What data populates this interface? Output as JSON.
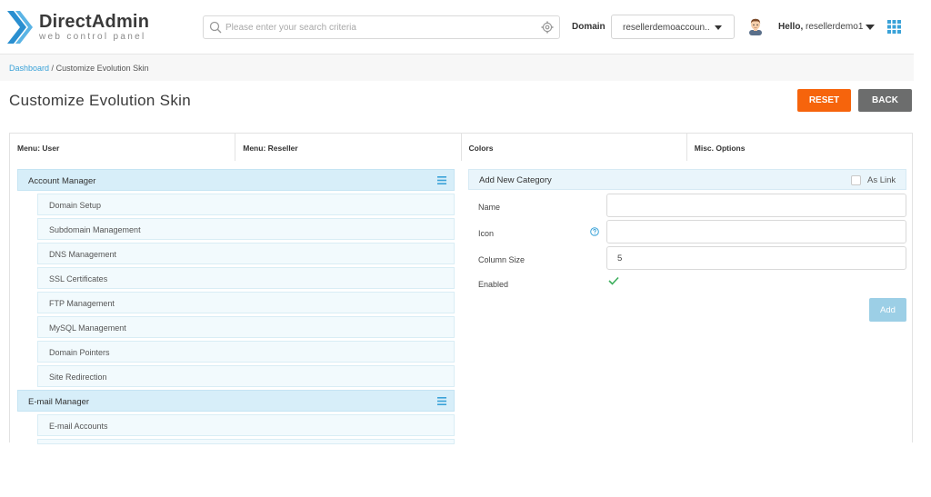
{
  "brand": {
    "title": "DirectAdmin",
    "subtitle": "web control panel"
  },
  "search": {
    "placeholder": "Please enter your search criteria",
    "value": ""
  },
  "domain": {
    "label": "Domain",
    "selected": "resellerdemoaccoun..."
  },
  "user": {
    "greeting": "Hello,",
    "name": "resellerdemo1"
  },
  "breadcrumb": {
    "root": "Dashboard",
    "separator": "/",
    "current": "Customize Evolution Skin"
  },
  "page": {
    "title": "Customize Evolution Skin"
  },
  "actions": {
    "reset": "RESET",
    "back": "BACK"
  },
  "tabs": [
    {
      "label": "Menu: User"
    },
    {
      "label": "Menu: Reseller"
    },
    {
      "label": "Colors"
    },
    {
      "label": "Misc. Options"
    }
  ],
  "menu": {
    "groups": [
      {
        "label": "Account Manager",
        "items": [
          "Domain Setup",
          "Subdomain Management",
          "DNS Management",
          "SSL Certificates",
          "FTP Management",
          "MySQL Management",
          "Domain Pointers",
          "Site Redirection"
        ]
      },
      {
        "label": "E-mail Manager",
        "items": [
          "E-mail Accounts"
        ]
      }
    ]
  },
  "category_form": {
    "header": "Add New Category",
    "as_link_label": "As Link",
    "as_link_checked": false,
    "name_label": "Name",
    "name_value": "",
    "icon_label": "Icon",
    "icon_value": "",
    "column_size_label": "Column Size",
    "column_size_value": "5",
    "enabled_label": "Enabled",
    "enabled": true,
    "add_button": "Add"
  },
  "colors": {
    "accent": "#3aa2d8",
    "reset": "#f6640c",
    "back": "#6c6d6d",
    "group_bg": "#d7eef9",
    "add_button": "#9ccfe6"
  }
}
